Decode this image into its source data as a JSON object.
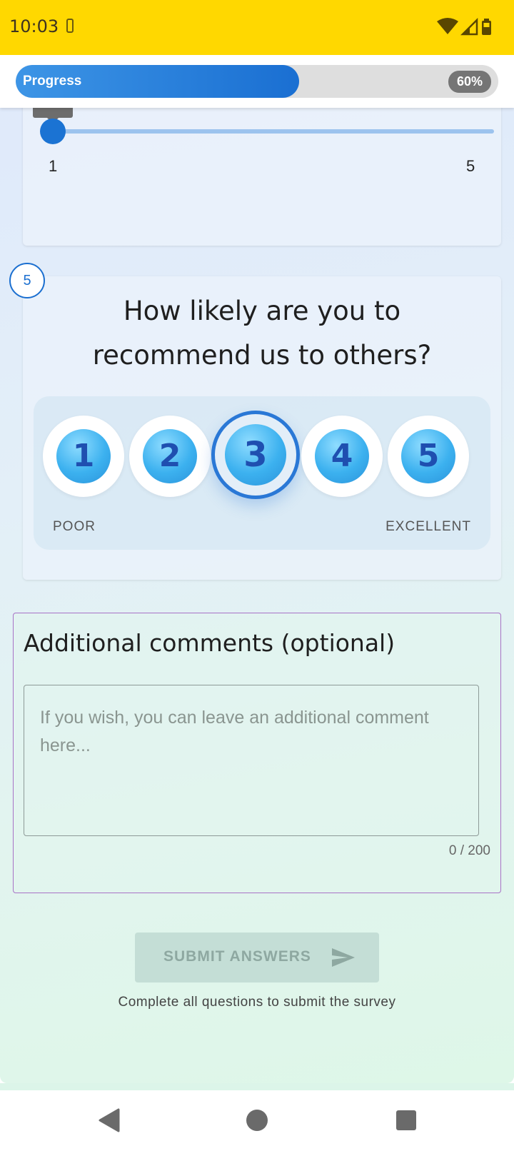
{
  "status_bar": {
    "time": "10:03"
  },
  "progress": {
    "label": "Progress",
    "value_percent": 60,
    "value_text": "60%"
  },
  "question4": {
    "slider_min_label": "1",
    "slider_max_label": "5",
    "slider_value": 1
  },
  "question5": {
    "number": "5",
    "title": "How likely are you to recommend us to others?",
    "options": [
      "1",
      "2",
      "3",
      "4",
      "5"
    ],
    "selected": "3",
    "scale_low_label": "POOR",
    "scale_high_label": "EXCELLENT"
  },
  "comments": {
    "title": "Additional comments (optional)",
    "placeholder": "If you wish, you can leave an additional comment here...",
    "value": "",
    "counter": "0 / 200"
  },
  "submit": {
    "label": "SUBMIT ANSWERS",
    "hint": "Complete all questions to submit the survey",
    "icon": "send-icon",
    "enabled": false
  },
  "colors": {
    "status_bar": "#FFD800",
    "accent": "#1b73d3",
    "comment_border": "#a872c6",
    "submit_disabled": "#c4ded6"
  }
}
